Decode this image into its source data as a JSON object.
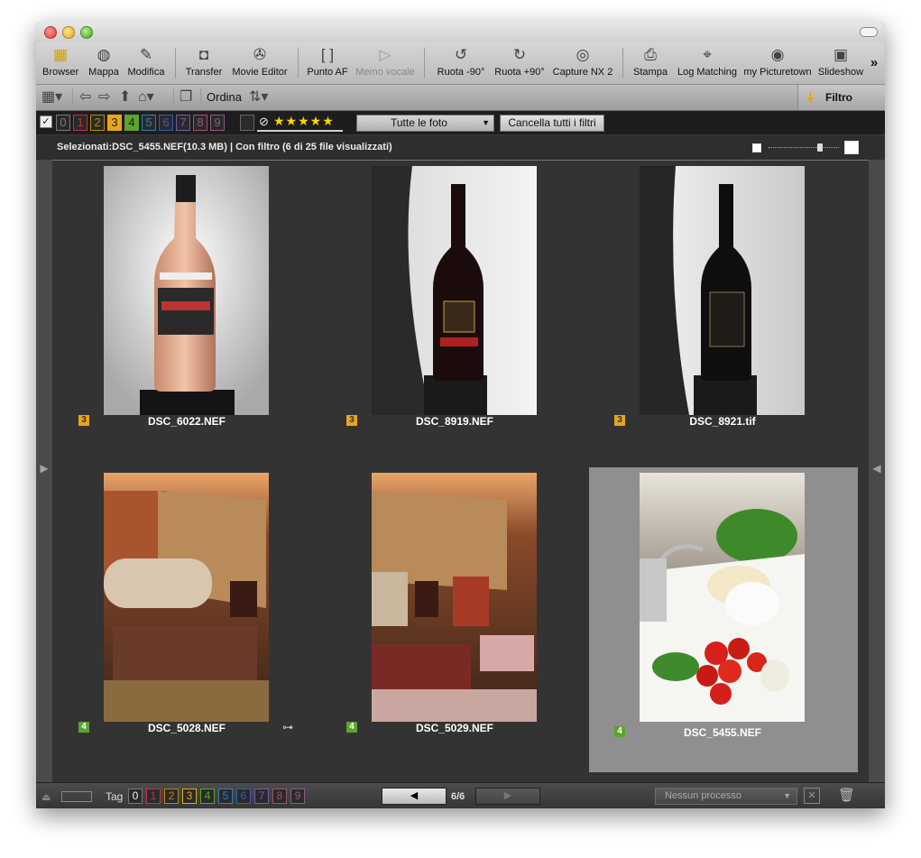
{
  "toolbar": {
    "items": [
      {
        "label": "Browser",
        "icon": "browser-icon"
      },
      {
        "label": "Mappa",
        "icon": "globe-icon"
      },
      {
        "label": "Modifica",
        "icon": "retouch-icon"
      },
      {
        "label": "Transfer",
        "icon": "camera-icon"
      },
      {
        "label": "Movie Editor",
        "icon": "film-reel-icon"
      },
      {
        "label": "Punto AF",
        "icon": "af-point-icon"
      },
      {
        "label": "Memo vocale",
        "icon": "voice-memo-icon",
        "disabled": true
      },
      {
        "label": "Ruota -90°",
        "icon": "rotate-left-icon"
      },
      {
        "label": "Ruota +90°",
        "icon": "rotate-right-icon"
      },
      {
        "label": "Capture NX 2",
        "icon": "capture-nx-icon"
      },
      {
        "label": "Stampa",
        "icon": "printer-icon"
      },
      {
        "label": "Log Matching",
        "icon": "log-matching-icon"
      },
      {
        "label": "my Picturetown",
        "icon": "picturetown-icon"
      },
      {
        "label": "Slideshow",
        "icon": "slideshow-icon"
      }
    ],
    "overflow": "»"
  },
  "secondary": {
    "sort_label": "Ordina",
    "filter_label": "Filtro"
  },
  "filter_bar": {
    "labels": [
      "0",
      "1",
      "2",
      "3",
      "4",
      "5",
      "6",
      "7",
      "8",
      "9"
    ],
    "label_colors": [
      "#777777",
      "#c8323c",
      "#b8860b",
      "#e8a619",
      "#5aa52b",
      "#2f7fb8",
      "#3c5ab0",
      "#7a5aa8",
      "#a0506e",
      "#8c5a8c"
    ],
    "highlighted_labels": [
      "3",
      "4"
    ],
    "stars": "★★★★★",
    "select_value": "Tutte le foto",
    "clear_button": "Cancella tutti i filtri"
  },
  "status": {
    "text": "Selezionati:DSC_5455.NEF(10.3 MB) | Con filtro (6 di 25 file visualizzati)"
  },
  "photos": [
    {
      "name": "DSC_6022.NEF",
      "label": "3",
      "subject": "rose wine bottle",
      "selected": false
    },
    {
      "name": "DSC_8919.NEF",
      "label": "3",
      "subject": "red wine bottle",
      "selected": false
    },
    {
      "name": "DSC_8921.tif",
      "label": "3",
      "subject": "amarone wine bottle",
      "selected": false
    },
    {
      "name": "DSC_5028.NEF",
      "label": "4",
      "subject": "gift box with salami",
      "selected": false,
      "hierarchy_icon": true
    },
    {
      "name": "DSC_5029.NEF",
      "label": "4",
      "subject": "gift box with cured meats",
      "selected": false
    },
    {
      "name": "DSC_5455.NEF",
      "label": "4",
      "subject": "mozzarella tomatoes and basil",
      "selected": true
    }
  ],
  "bottom": {
    "tag_label": "Tag",
    "tags": [
      "0",
      "1",
      "2",
      "3",
      "4",
      "5",
      "6",
      "7",
      "8",
      "9"
    ],
    "page": "6/6",
    "process_value": "Nessun processo"
  }
}
